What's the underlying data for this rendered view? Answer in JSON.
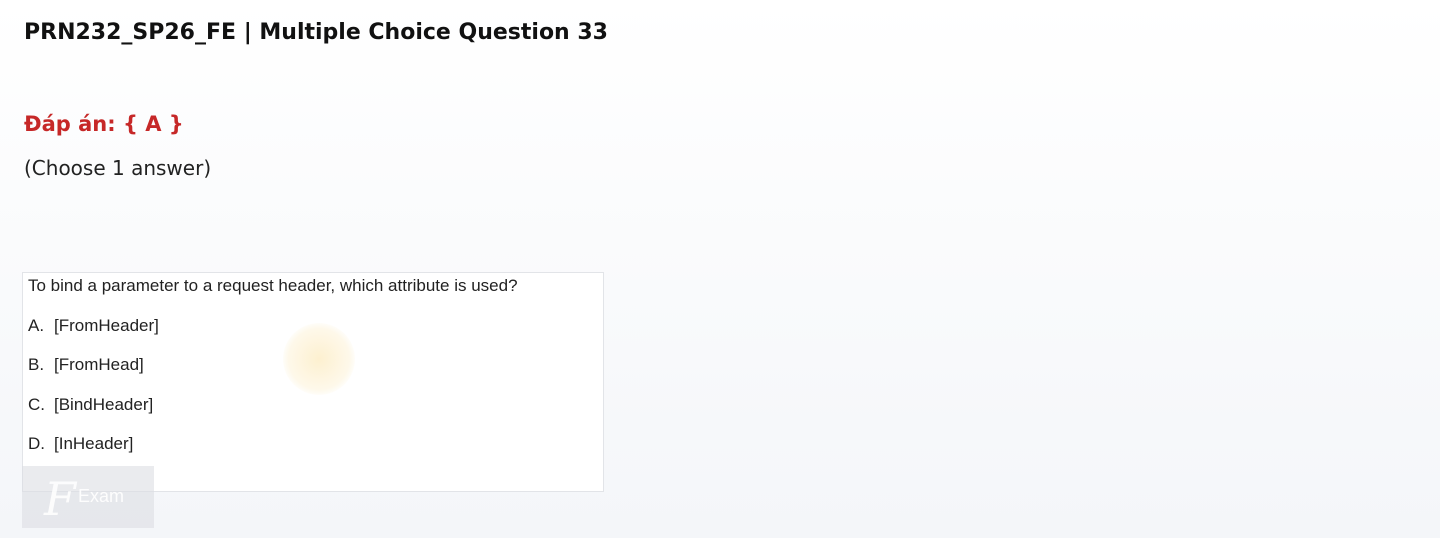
{
  "header": {
    "title": "PRN232_SP26_FE | Multiple Choice Question 33"
  },
  "answer": {
    "label": "Đáp án: { A }"
  },
  "instruction": "(Choose 1 answer)",
  "question": {
    "text": "To bind a parameter to a request header, which attribute is used?",
    "options": [
      {
        "letter": "A.",
        "text": "[FromHeader]"
      },
      {
        "letter": "B.",
        "text": "[FromHead]"
      },
      {
        "letter": "C.",
        "text": "[BindHeader]"
      },
      {
        "letter": "D.",
        "text": "[InHeader]"
      }
    ]
  },
  "watermark": {
    "glyph": "F",
    "text": "Exam"
  },
  "colors": {
    "answer": "#c62828",
    "title": "#111111"
  }
}
